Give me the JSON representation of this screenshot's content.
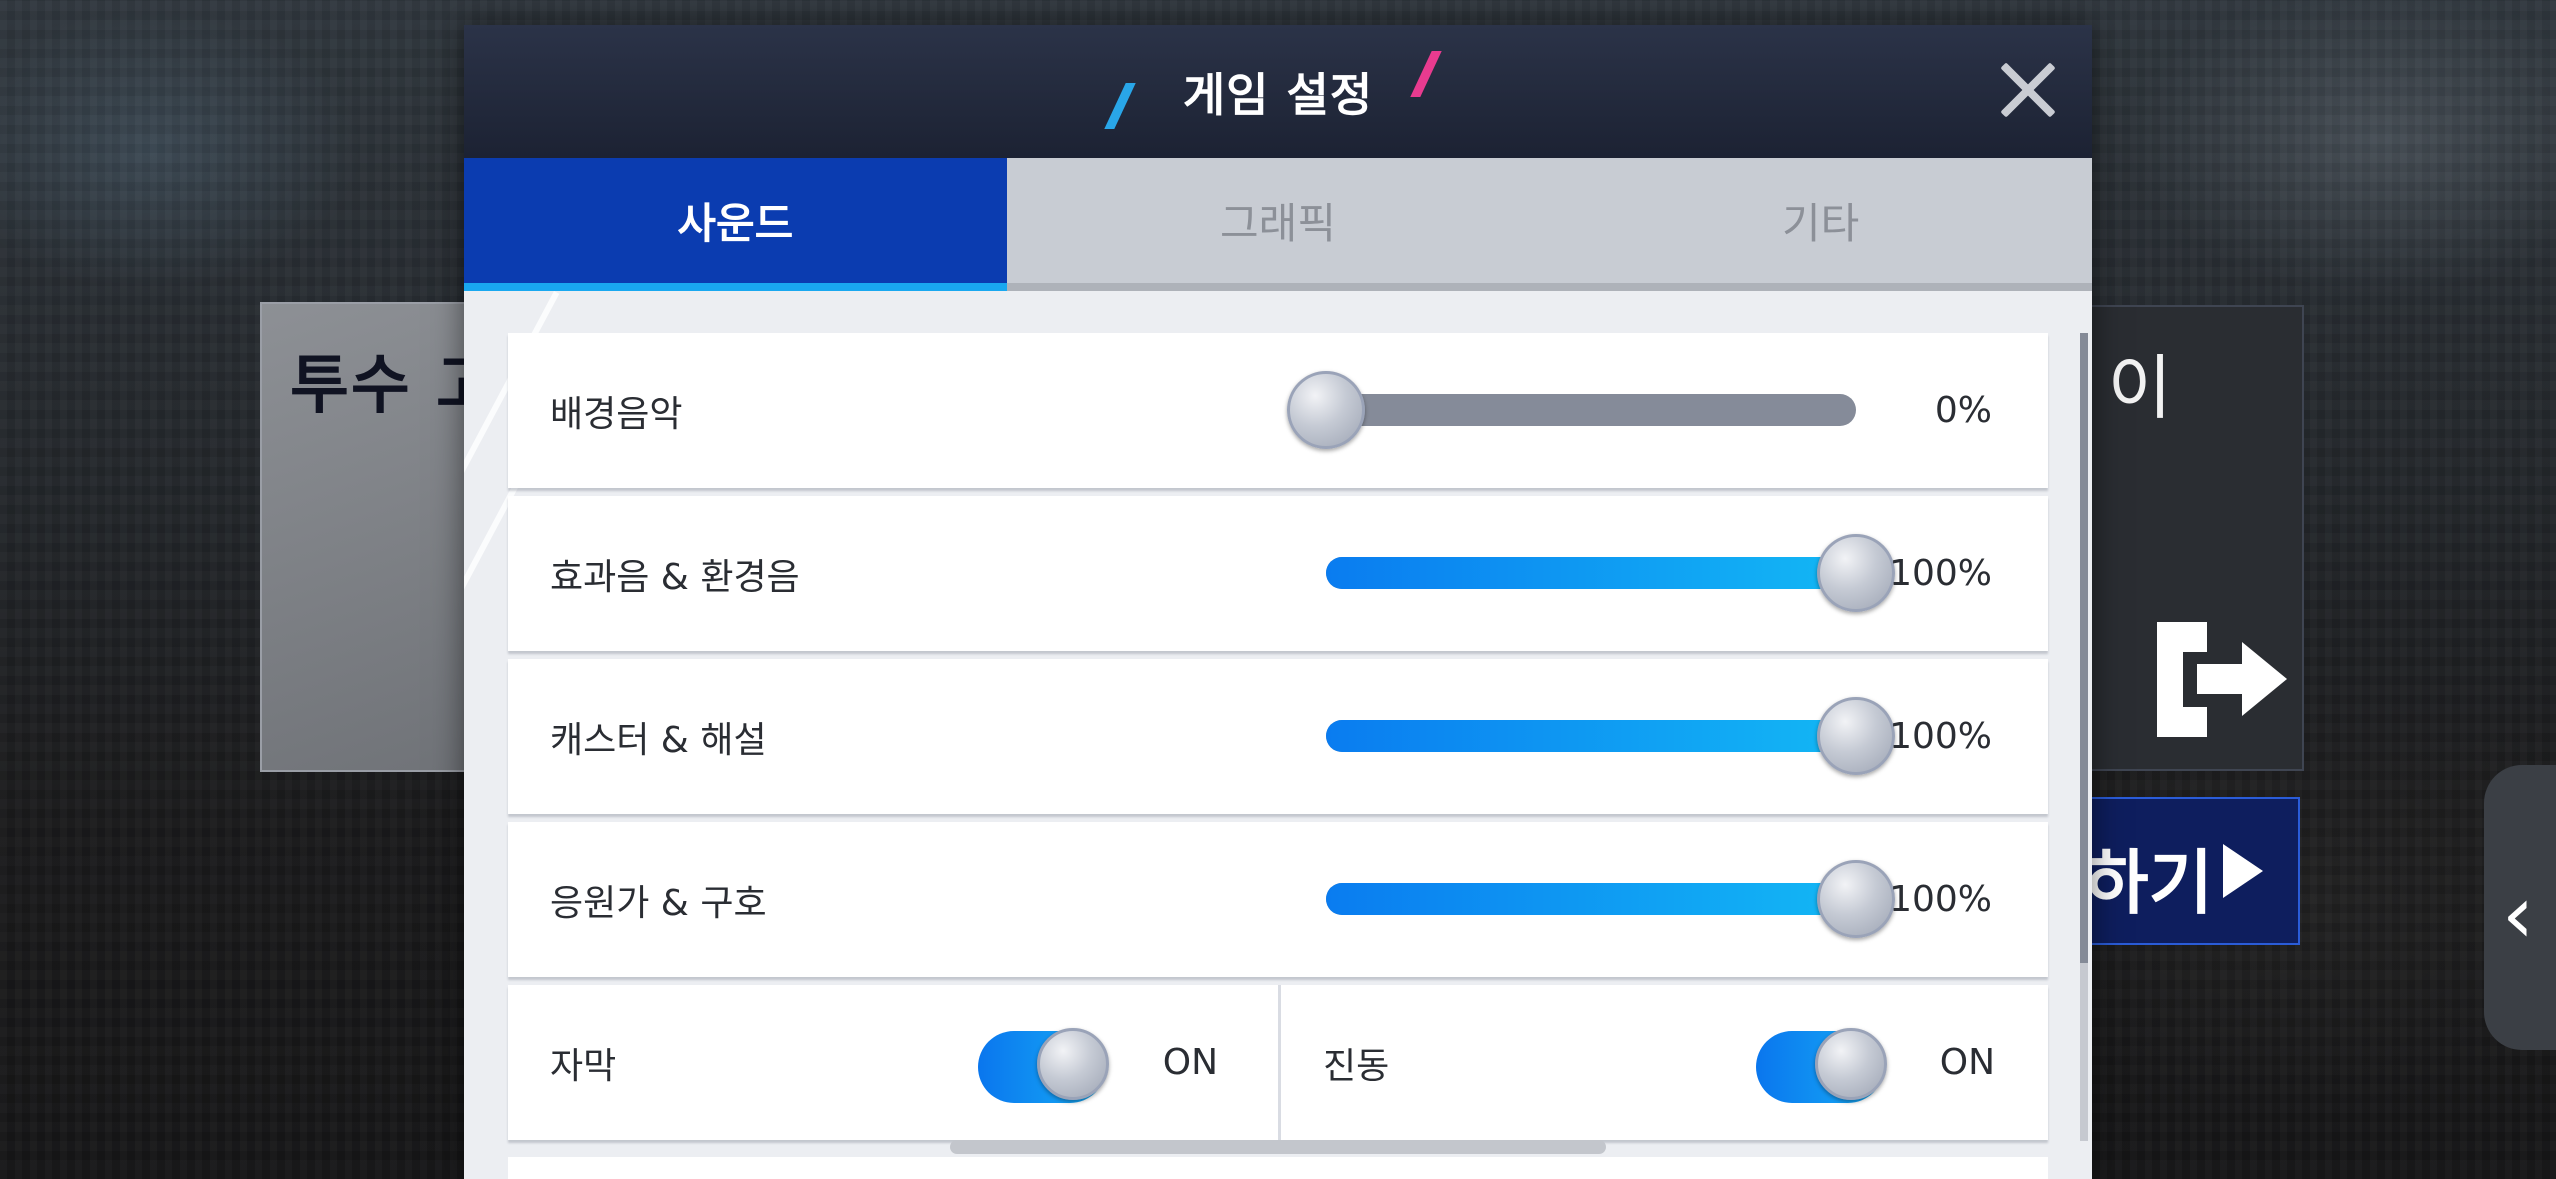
{
  "modal": {
    "title": "게임 설정",
    "tabs": [
      {
        "label": "사운드",
        "active": true
      },
      {
        "label": "그래픽",
        "active": false
      },
      {
        "label": "기타",
        "active": false
      }
    ],
    "sound_settings": [
      {
        "label": "배경음악",
        "value": "0%",
        "level": 0
      },
      {
        "label": "효과음 & 환경음",
        "value": "100%",
        "level": 1
      },
      {
        "label": "캐스터 & 해설",
        "value": "100%",
        "level": 1
      },
      {
        "label": "응원가 & 구호",
        "value": "100%",
        "level": 1
      }
    ],
    "toggles": [
      {
        "label": "자막",
        "state": "ON"
      },
      {
        "label": "진동",
        "state": "ON"
      }
    ]
  },
  "background": {
    "left_card_title": "투수 고",
    "right_card_title": "이",
    "start_button_label": "하기",
    "exit_icon": "exit-icon",
    "side_handle_icon": "chevron-left-icon"
  },
  "colors": {
    "accent_blue": "#0b3cb0",
    "slider_fill": "#13b8f5",
    "header_bg": "#1c2233"
  }
}
